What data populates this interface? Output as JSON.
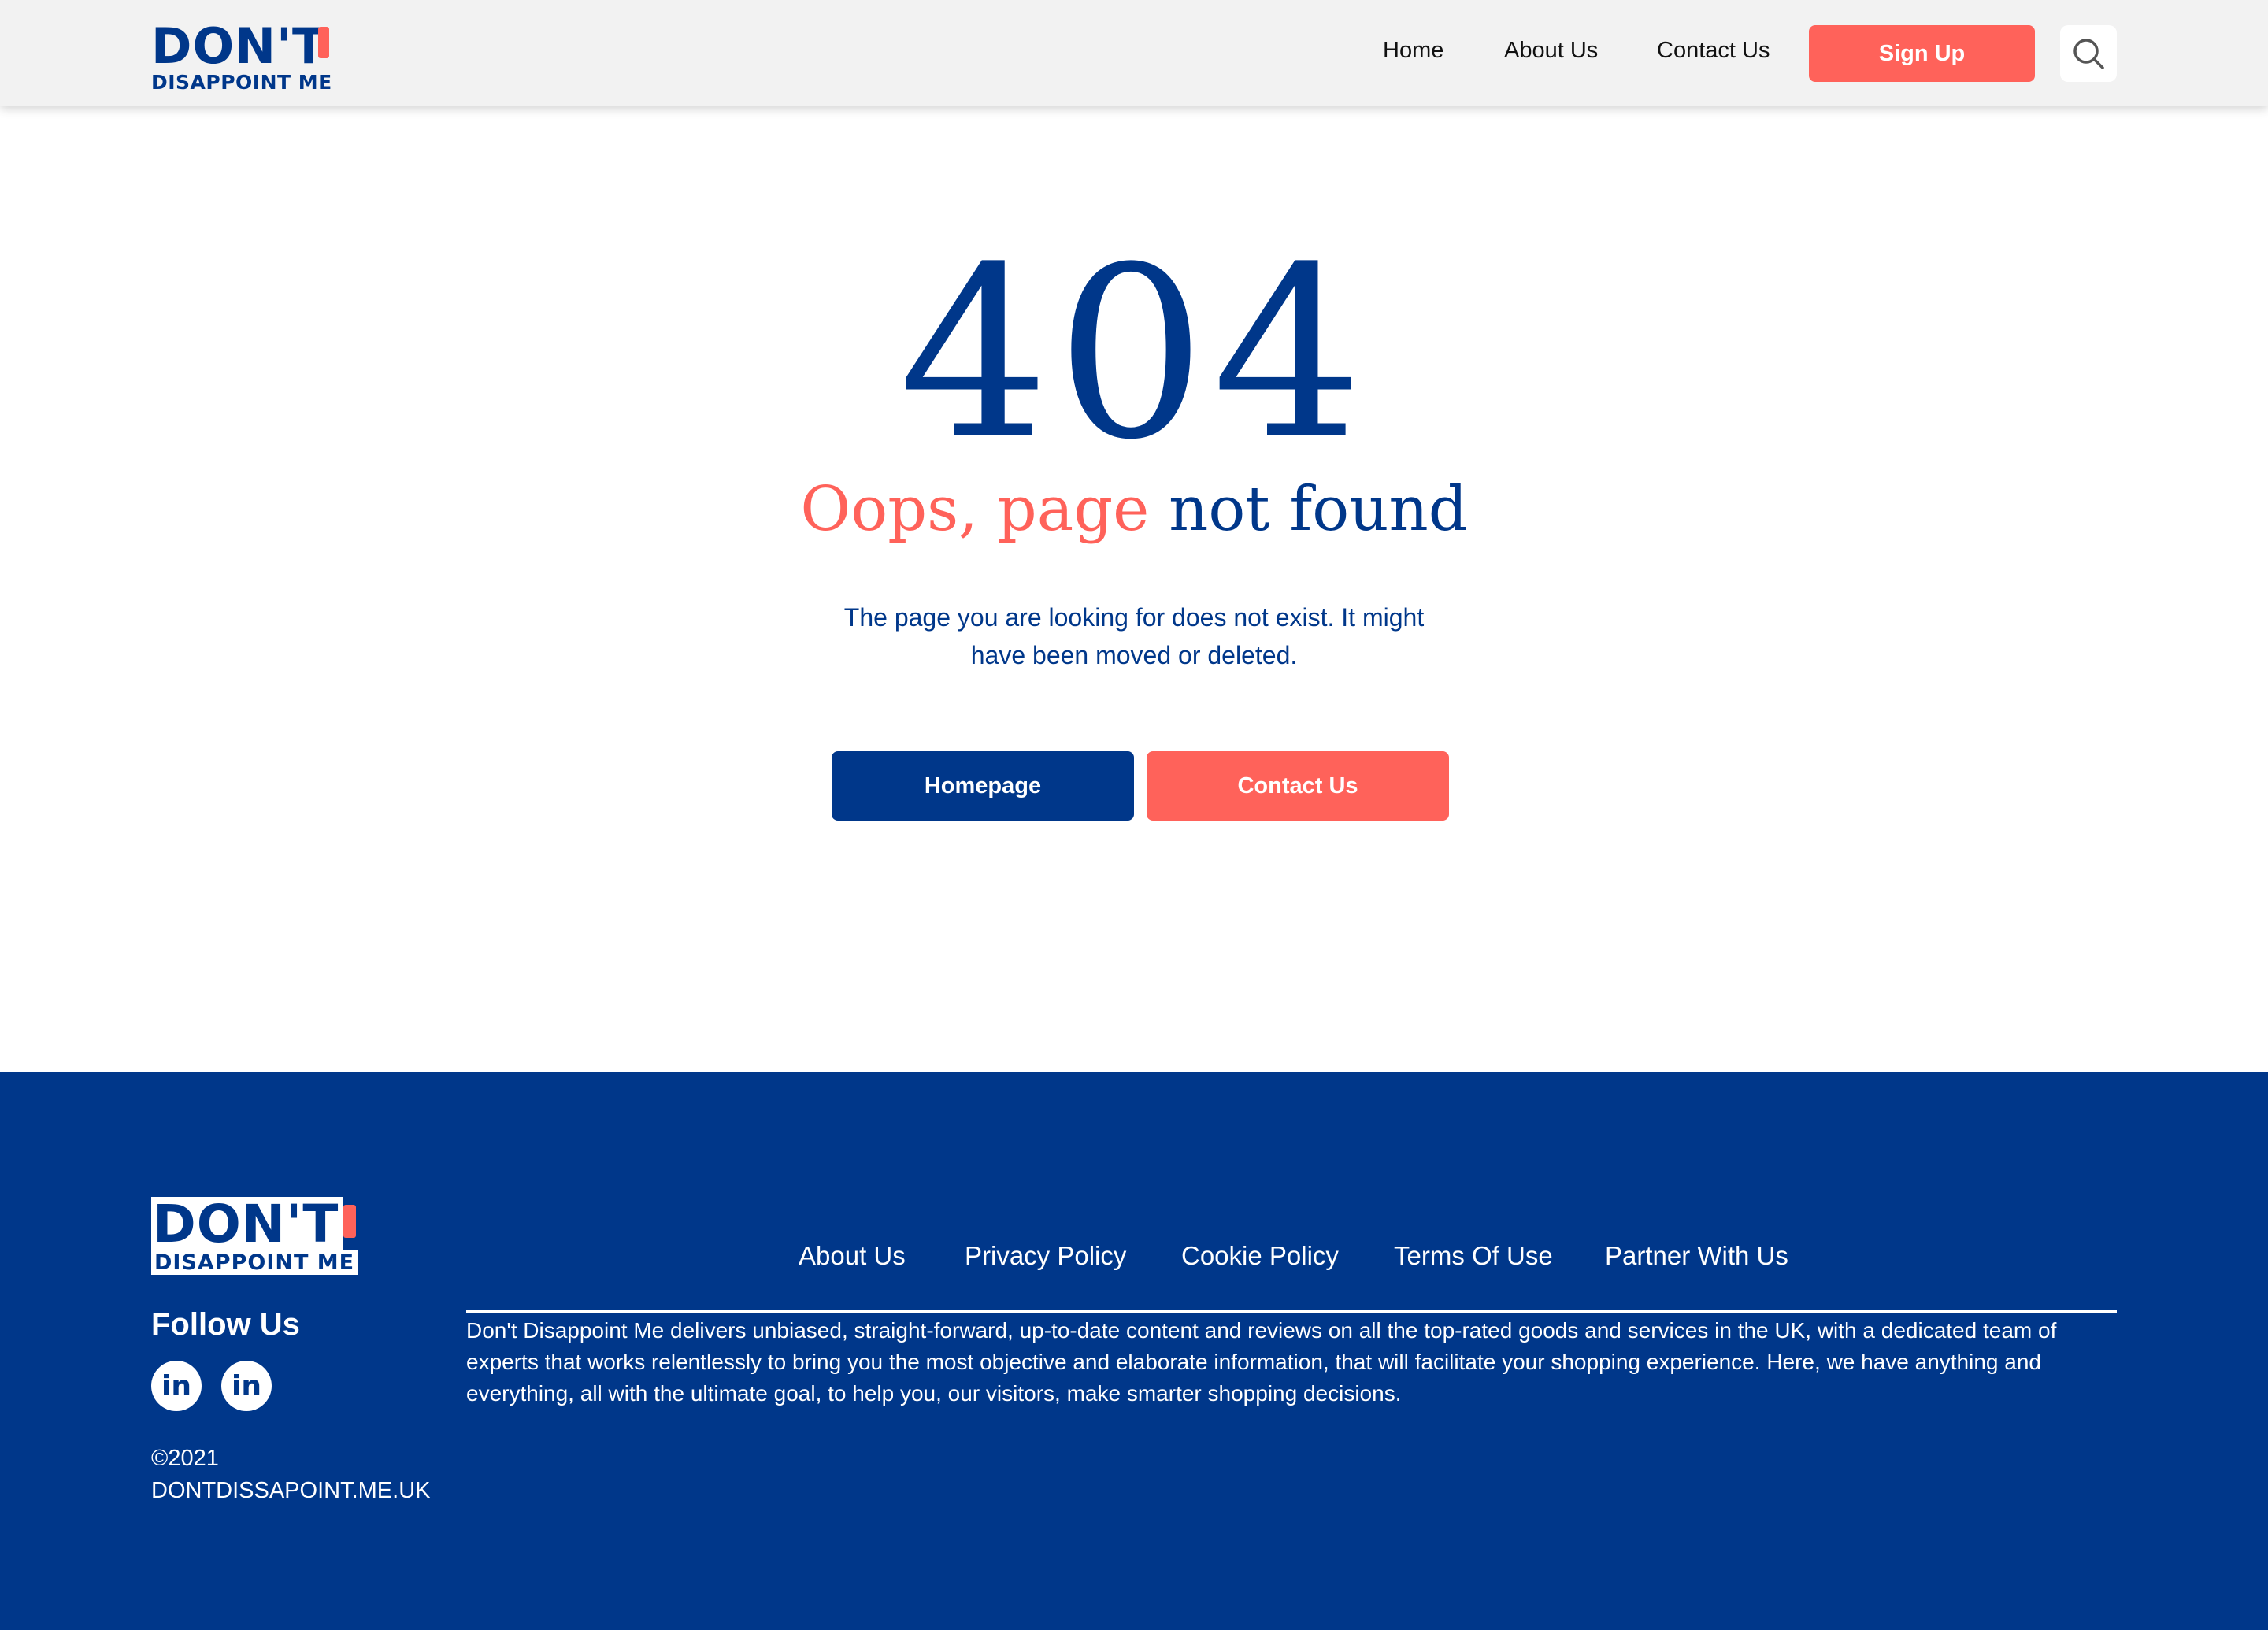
{
  "brand": {
    "line1": "DON'T",
    "line2": "DISAPPOINT ME"
  },
  "header": {
    "nav": {
      "home": "Home",
      "about": "About Us",
      "contact": "Contact Us"
    },
    "signup_label": "Sign Up",
    "search_icon": "search-icon"
  },
  "main": {
    "code": "404",
    "title_part1": "Oops, page",
    "title_part2": "not found",
    "description": "The page you are looking for does not exist. It might have been moved or deleted.",
    "homepage_label": "Homepage",
    "contact_label": "Contact Us"
  },
  "footer": {
    "follow_title": "Follow Us",
    "social": [
      {
        "icon": "linkedin-icon",
        "label": "in"
      },
      {
        "icon": "linkedin-icon",
        "label": "in"
      }
    ],
    "copyright_year": "©2021",
    "copyright_site": "DONTDISSAPOINT.ME.UK",
    "links": {
      "about": "About Us",
      "privacy": "Privacy Policy",
      "cookie": "Cookie Policy",
      "terms": "Terms Of Use",
      "partner": "Partner With Us"
    },
    "about_text": "Don't Disappoint Me delivers unbiased, straight-forward, up-to-date content and reviews on all the top-rated goods and services in the UK, with a dedicated team of experts that works relentlessly to bring you the most objective and elaborate information, that will facilitate your shopping experience. Here, we have anything and everything, all with the ultimate goal, to help you, our visitors, make smarter shopping decisions."
  },
  "colors": {
    "navy": "#00378a",
    "coral": "#ff625a",
    "header_bg": "#f2f2f2"
  }
}
